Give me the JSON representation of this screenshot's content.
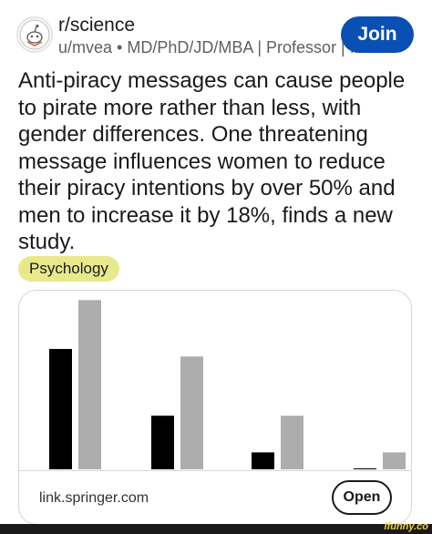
{
  "post": {
    "subreddit": "r/science",
    "author_line": "u/mvea • MD/PhD/JD/MBA | Professor | ...",
    "join_label": "Join",
    "title": "Anti-piracy messages can cause people to pirate more rather than less, with gender differences. One threatening message influences women to reduce their piracy intentions by over 50% and men to increase it by 18%, finds a new study.",
    "flair": "Psychology"
  },
  "link_card": {
    "domain": "link.springer.com",
    "open_label": "Open"
  },
  "watermark": {
    "text": "ifunny.co"
  },
  "colors": {
    "join_button": "#0a4fb3",
    "flair_bg": "#e8e98c",
    "series_dark": "#000000",
    "series_light": "#adadad"
  },
  "chart_data": {
    "type": "bar",
    "categories": [
      "",
      "",
      "",
      ""
    ],
    "series": [
      {
        "values": [
          128,
          57,
          18,
          1
        ]
      },
      {
        "values": [
          180,
          120,
          57,
          18
        ]
      }
    ],
    "ylim": [
      0,
      190
    ],
    "grid": false,
    "legend": "none"
  }
}
